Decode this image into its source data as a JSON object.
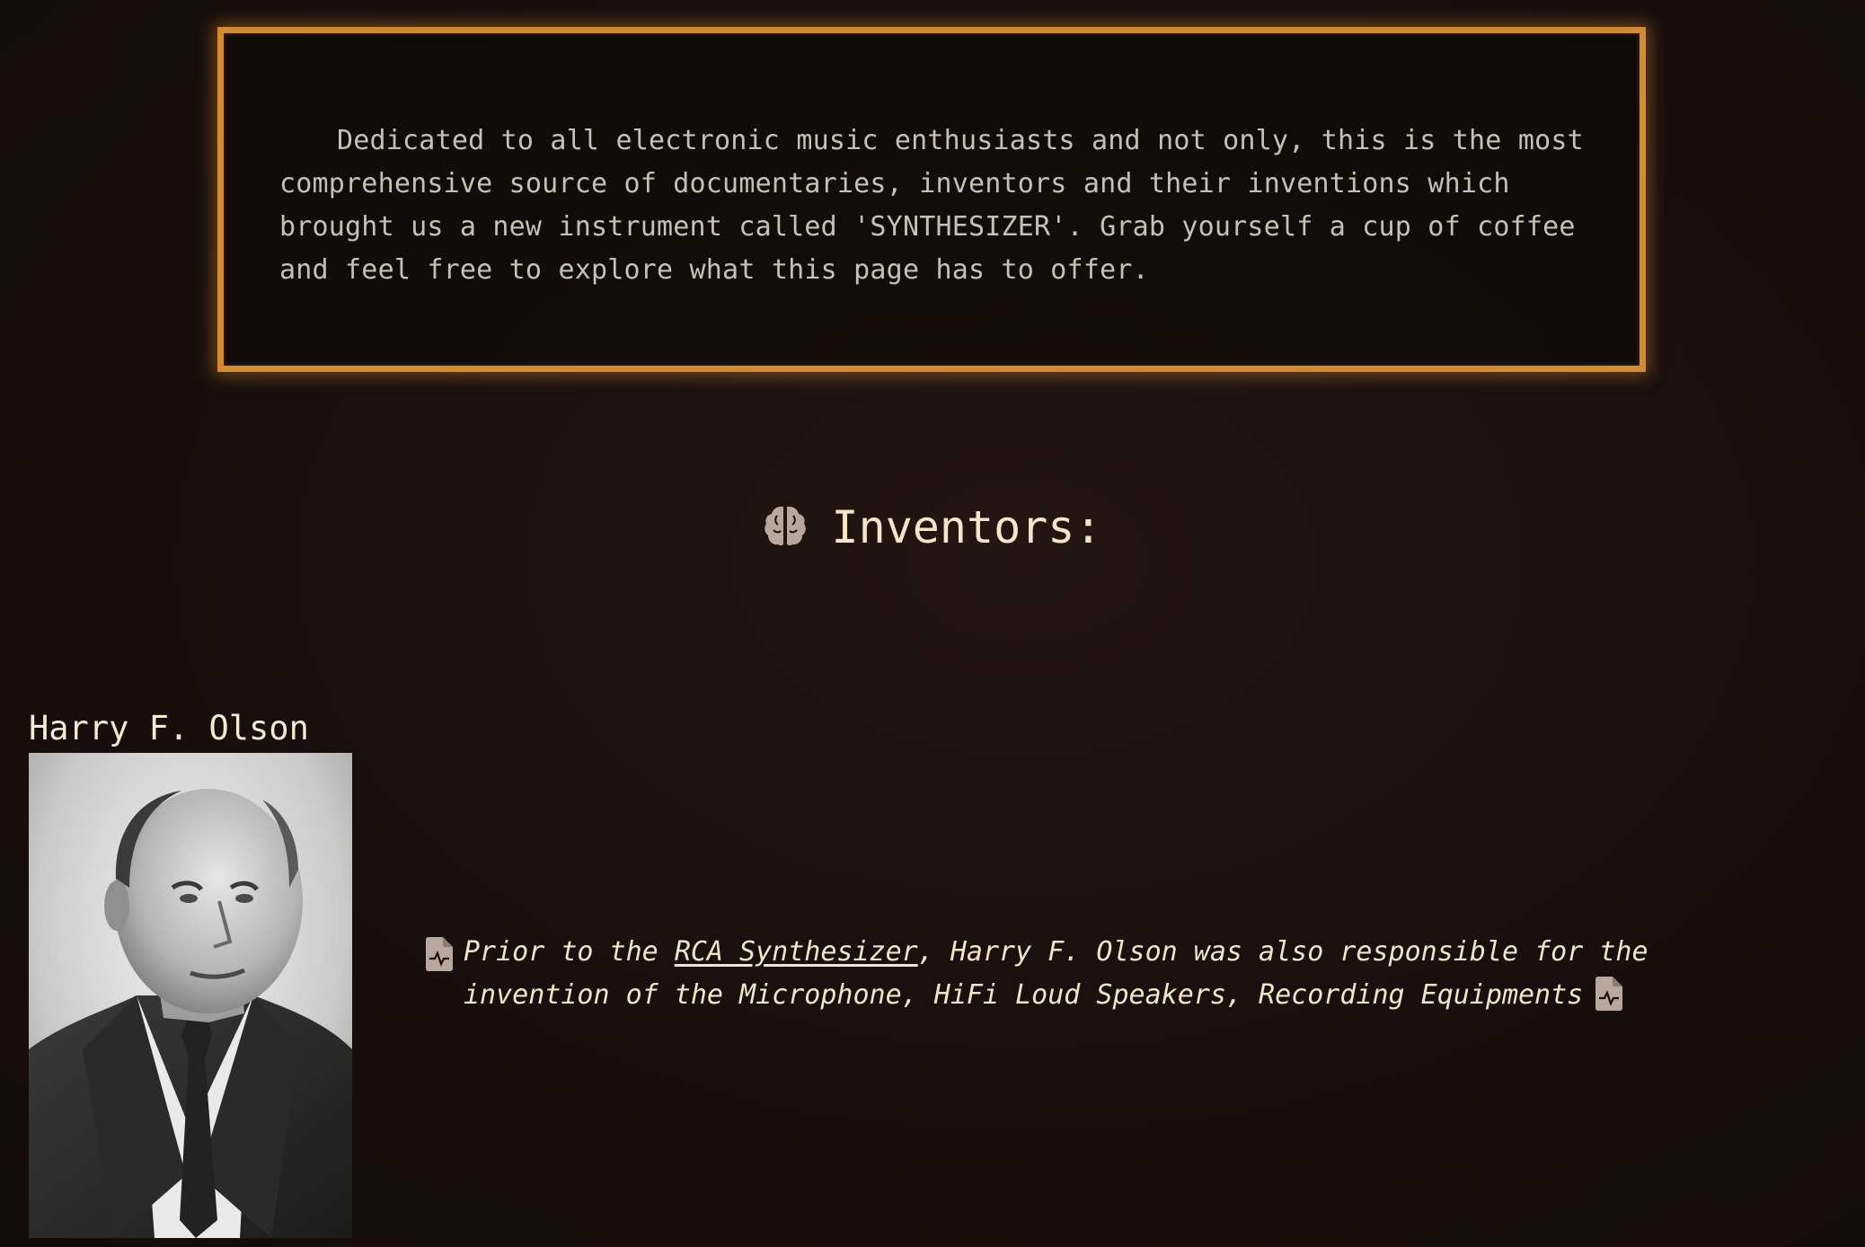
{
  "intro": {
    "text": "Dedicated to all electronic music enthusiasts and not only, this is the most comprehensive source of documentaries, inventors and their inventions which brought us a new instrument called 'SYNTHESIZER'. Grab yourself a cup of coffee and feel free to explore what this page has to offer."
  },
  "inventors_section": {
    "heading": "Inventors:",
    "icon": "brain-icon"
  },
  "inventor": {
    "name": "Harry F. Olson",
    "desc_prefix": "Prior to the ",
    "link_text": "RCA Synthesizer",
    "desc_suffix": ", Harry F. Olson was also responsible for the invention of the Microphone, HiFi Loud Speakers, Recording Equipments",
    "icon": "file-waveform-icon"
  },
  "colors": {
    "background": "#1a100e",
    "box_border": "#d48a2e",
    "heading_text": "#f3e6c8",
    "body_text": "#c9c0b4",
    "icon": "#b8a79c"
  }
}
